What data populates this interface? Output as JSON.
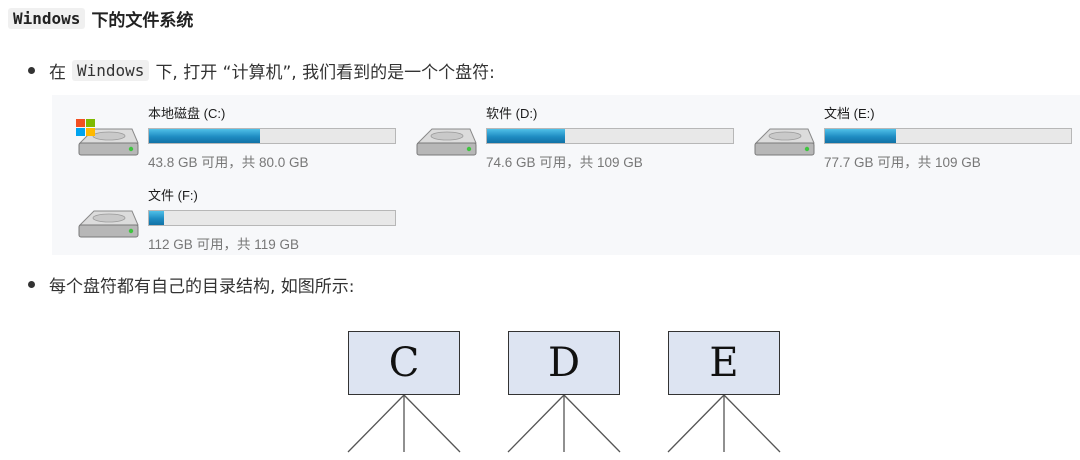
{
  "heading": {
    "code": "Windows",
    "text": "下的文件系统"
  },
  "bullet1": {
    "before": "在",
    "code": "Windows",
    "after": "下, 打开 “计算机”, 我们看到的是一个个盘符:"
  },
  "drives": [
    {
      "name": "本地磁盘 (C:)",
      "info": "43.8 GB 可用，共 80.0 GB",
      "used_fraction": 0.452,
      "system": true
    },
    {
      "name": "软件 (D:)",
      "info": "74.6 GB 可用，共 109 GB",
      "used_fraction": 0.316,
      "system": false
    },
    {
      "name": "文档 (E:)",
      "info": "77.7 GB 可用，共 109 GB",
      "used_fraction": 0.287,
      "system": false
    },
    {
      "name": "文件 (F:)",
      "info": "112 GB 可用，共 119 GB",
      "used_fraction": 0.06,
      "system": false
    }
  ],
  "bullet2": {
    "text": "每个盘符都有自己的目录结构, 如图所示:"
  },
  "tree": {
    "nodes": [
      "C",
      "D",
      "E"
    ]
  },
  "colors": {
    "bar_fill": "#1f8cc2",
    "node_fill": "#dde4f2",
    "panel_bg": "#f7f8fa"
  }
}
